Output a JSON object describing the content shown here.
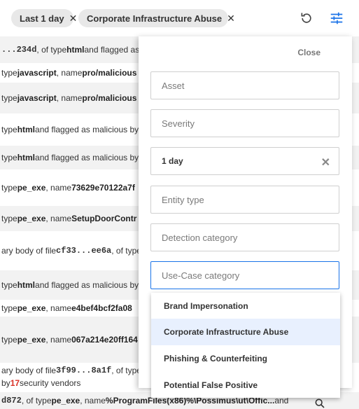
{
  "filters": {
    "chips": [
      {
        "label": "Last 1 day"
      },
      {
        "label": "Corporate Infrastructure Abuse"
      }
    ]
  },
  "icons": {
    "reset": "refresh-icon",
    "filter": "tune-icon",
    "search": "search-icon"
  },
  "rows": [
    {
      "pre": "...234d",
      "t1": ", of type ",
      "b1": "html",
      "t2": " and flagged as"
    },
    {
      "t1": "type ",
      "b1": "javascript",
      "t2": ", name ",
      "b2": "pro/malicious"
    },
    {
      "t1": "type ",
      "b1": "javascript",
      "t2": ", name ",
      "b2": "pro/malicious"
    },
    {
      "t1": "type ",
      "b1": "html",
      "t2": " and flagged as malicious by"
    },
    {
      "t1": "type ",
      "b1": "html",
      "t2": " and flagged as malicious by"
    },
    {
      "t1": "type ",
      "b1": "pe_exe",
      "t2": ", name ",
      "b2": "73629e70122a7f"
    },
    {
      "t1": "type ",
      "b1": "pe_exe",
      "t2": ", name ",
      "b2": "SetupDoorContr"
    },
    {
      "t1": "ary body of file ",
      "mono": "cf33...ee6a",
      "t2": ", of type"
    },
    {
      "t1": "type ",
      "b1": "html",
      "t2": " and flagged as malicious by"
    },
    {
      "t1": "type ",
      "b1": "pe_exe",
      "t2": ", name ",
      "b2": "e4bef4bcf2fa08"
    },
    {
      "t1": "type ",
      "b1": "pe_exe",
      "t2": ", name ",
      "b2": "067a214e20ff164"
    },
    {
      "t1": "ary body of file ",
      "mono": "3f99...8a1f",
      "t2": ", of type"
    },
    {
      "t1": "by ",
      "red": "17",
      "t2": " security vendors"
    },
    {
      "pre": "d872",
      "t1": ", of type ",
      "b1": "pe_exe",
      "t2": ", name ",
      "b2": "%ProgramFiles(x86)%\\Possimus\\ut\\Offic...",
      "t3": " and"
    }
  ],
  "panel": {
    "close_label": "Close",
    "fields": [
      {
        "placeholder": "Asset",
        "value": ""
      },
      {
        "placeholder": "Severity",
        "value": ""
      },
      {
        "placeholder": "",
        "value": "1 day"
      },
      {
        "placeholder": "Entity type",
        "value": ""
      },
      {
        "placeholder": "Detection category",
        "value": ""
      },
      {
        "placeholder": "Use-Case category",
        "value": ""
      }
    ],
    "dropdown_options": [
      {
        "label": "Brand Impersonation",
        "selected": false
      },
      {
        "label": "Corporate Infrastructure Abuse",
        "selected": true
      },
      {
        "label": "Phishing & Counterfeiting",
        "selected": false
      },
      {
        "label": "Potential False Positive",
        "selected": false
      }
    ],
    "colors": {
      "focus": "#1a73e8",
      "selected_bg": "#e8f0fe",
      "vendor_count": "#d93025"
    }
  }
}
